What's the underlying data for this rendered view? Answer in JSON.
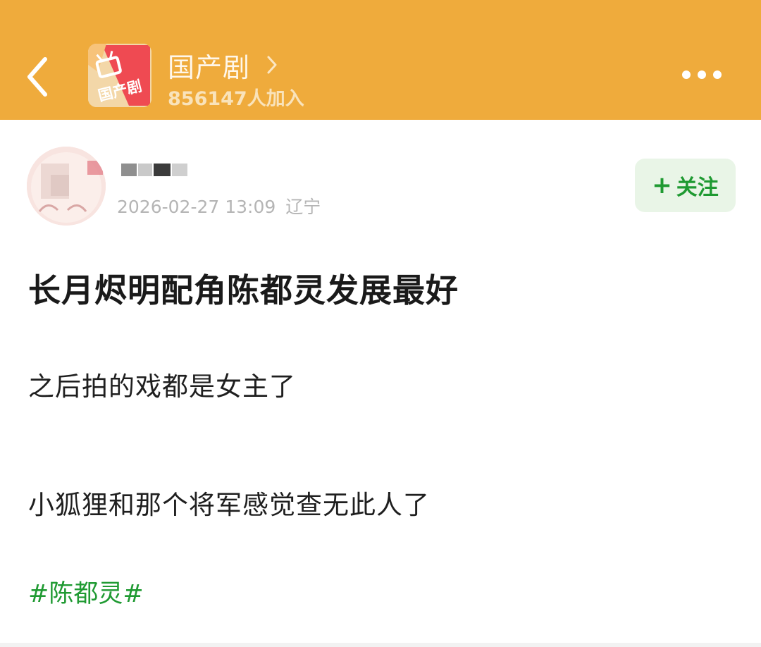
{
  "header": {
    "back_icon": "chevron-left-icon",
    "group_icon": "tv-group-logo",
    "group_icon_text": "国产剧",
    "group_title": "国产剧",
    "title_chevron_icon": "chevron-right-icon",
    "member_count": "856147人加入",
    "more_icon": "more-horizontal-icon",
    "background_color": "#efab3c"
  },
  "post": {
    "author": {
      "avatar_icon": "user-avatar",
      "timestamp": "2026-02-27 13:09",
      "location": "辽宁"
    },
    "follow_button": {
      "plus": "+",
      "label": "关注",
      "color": "#1f9a32"
    },
    "title": "长月烬明配角陈都灵发展最好",
    "paragraphs": [
      "之后拍的戏都是女主了",
      "小狐狸和那个将军感觉查无此人了"
    ],
    "hashtag": "#陈都灵#"
  }
}
